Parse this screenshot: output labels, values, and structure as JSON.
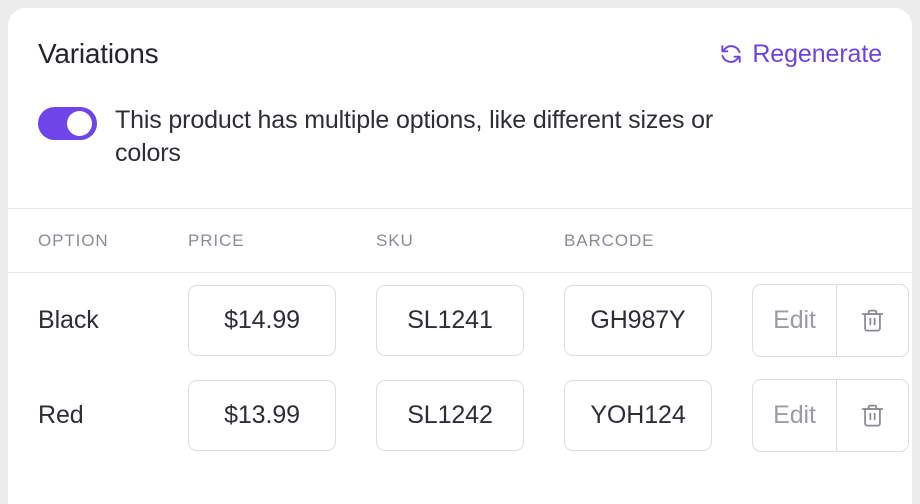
{
  "card": {
    "title": "Variations",
    "regenerate": {
      "label": "Regenerate",
      "icon": "refresh-icon",
      "color": "#6d44e4"
    },
    "toggle": {
      "label": "This product has multiple options, like different sizes or colors",
      "state": "on",
      "color": "#6f44e8"
    }
  },
  "table": {
    "headers": {
      "option": "OPTION",
      "price": "PRICE",
      "sku": "SKU",
      "barcode": "BARCODE"
    },
    "rows": [
      {
        "option": "Black",
        "price": "$14.99",
        "sku": "SL1241",
        "barcode": "GH987Y",
        "edit_label": "Edit",
        "delete_icon": "trash-icon"
      },
      {
        "option": "Red",
        "price": "$13.99",
        "sku": "SL1242",
        "barcode": "YOH124",
        "edit_label": "Edit",
        "delete_icon": "trash-icon"
      }
    ]
  }
}
